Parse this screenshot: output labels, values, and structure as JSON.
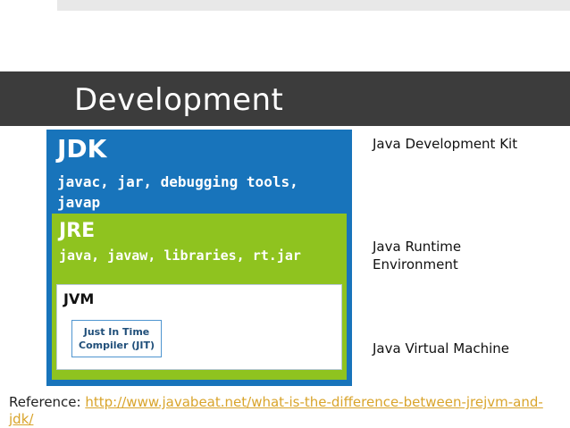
{
  "slide": {
    "title": "Development",
    "jdk": {
      "heading": "JDK",
      "tools": "javac, jar, debugging tools, javap",
      "description": "Java Development Kit"
    },
    "jre": {
      "heading": "JRE",
      "tools": "java, javaw, libraries, rt.jar",
      "description": "Java Runtime Environment"
    },
    "jvm": {
      "heading": "JVM",
      "jit_label": "Just In Time Compiler (JIT)",
      "description": "Java Virtual Machine"
    },
    "reference": {
      "label": "Reference: ",
      "link": "http://www.javabeat.net/what-is-the-difference-between-jrejvm-and-jdk/"
    }
  },
  "colors": {
    "title_bar": "#3c3c3c",
    "jdk_blue": "#1874bb",
    "jre_green": "#8fc31f",
    "link": "#d9a42b"
  }
}
